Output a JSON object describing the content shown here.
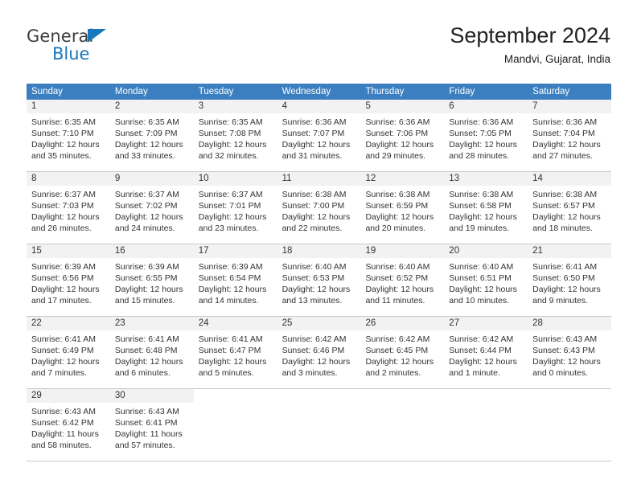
{
  "logo": {
    "name_top": "General",
    "name_bottom": "Blue",
    "triangle_color": "#1878be",
    "top_color": "#3c3c3c"
  },
  "header": {
    "title": "September 2024",
    "subtitle": "Mandvi, Gujarat, India"
  },
  "theme": {
    "header_bg": "#3c7fc0",
    "header_text": "#ffffff",
    "daynum_band_bg": "#f2f2f2",
    "grid_line": "#c8c8c8"
  },
  "weekdays": [
    {
      "label": "Sunday"
    },
    {
      "label": "Monday"
    },
    {
      "label": "Tuesday"
    },
    {
      "label": "Wednesday"
    },
    {
      "label": "Thursday"
    },
    {
      "label": "Friday"
    },
    {
      "label": "Saturday"
    }
  ],
  "weeks": [
    [
      {
        "day": "1",
        "sunrise": "Sunrise: 6:35 AM",
        "sunset": "Sunset: 7:10 PM",
        "daylight1": "Daylight: 12 hours",
        "daylight2": "and 35 minutes."
      },
      {
        "day": "2",
        "sunrise": "Sunrise: 6:35 AM",
        "sunset": "Sunset: 7:09 PM",
        "daylight1": "Daylight: 12 hours",
        "daylight2": "and 33 minutes."
      },
      {
        "day": "3",
        "sunrise": "Sunrise: 6:35 AM",
        "sunset": "Sunset: 7:08 PM",
        "daylight1": "Daylight: 12 hours",
        "daylight2": "and 32 minutes."
      },
      {
        "day": "4",
        "sunrise": "Sunrise: 6:36 AM",
        "sunset": "Sunset: 7:07 PM",
        "daylight1": "Daylight: 12 hours",
        "daylight2": "and 31 minutes."
      },
      {
        "day": "5",
        "sunrise": "Sunrise: 6:36 AM",
        "sunset": "Sunset: 7:06 PM",
        "daylight1": "Daylight: 12 hours",
        "daylight2": "and 29 minutes."
      },
      {
        "day": "6",
        "sunrise": "Sunrise: 6:36 AM",
        "sunset": "Sunset: 7:05 PM",
        "daylight1": "Daylight: 12 hours",
        "daylight2": "and 28 minutes."
      },
      {
        "day": "7",
        "sunrise": "Sunrise: 6:36 AM",
        "sunset": "Sunset: 7:04 PM",
        "daylight1": "Daylight: 12 hours",
        "daylight2": "and 27 minutes."
      }
    ],
    [
      {
        "day": "8",
        "sunrise": "Sunrise: 6:37 AM",
        "sunset": "Sunset: 7:03 PM",
        "daylight1": "Daylight: 12 hours",
        "daylight2": "and 26 minutes."
      },
      {
        "day": "9",
        "sunrise": "Sunrise: 6:37 AM",
        "sunset": "Sunset: 7:02 PM",
        "daylight1": "Daylight: 12 hours",
        "daylight2": "and 24 minutes."
      },
      {
        "day": "10",
        "sunrise": "Sunrise: 6:37 AM",
        "sunset": "Sunset: 7:01 PM",
        "daylight1": "Daylight: 12 hours",
        "daylight2": "and 23 minutes."
      },
      {
        "day": "11",
        "sunrise": "Sunrise: 6:38 AM",
        "sunset": "Sunset: 7:00 PM",
        "daylight1": "Daylight: 12 hours",
        "daylight2": "and 22 minutes."
      },
      {
        "day": "12",
        "sunrise": "Sunrise: 6:38 AM",
        "sunset": "Sunset: 6:59 PM",
        "daylight1": "Daylight: 12 hours",
        "daylight2": "and 20 minutes."
      },
      {
        "day": "13",
        "sunrise": "Sunrise: 6:38 AM",
        "sunset": "Sunset: 6:58 PM",
        "daylight1": "Daylight: 12 hours",
        "daylight2": "and 19 minutes."
      },
      {
        "day": "14",
        "sunrise": "Sunrise: 6:38 AM",
        "sunset": "Sunset: 6:57 PM",
        "daylight1": "Daylight: 12 hours",
        "daylight2": "and 18 minutes."
      }
    ],
    [
      {
        "day": "15",
        "sunrise": "Sunrise: 6:39 AM",
        "sunset": "Sunset: 6:56 PM",
        "daylight1": "Daylight: 12 hours",
        "daylight2": "and 17 minutes."
      },
      {
        "day": "16",
        "sunrise": "Sunrise: 6:39 AM",
        "sunset": "Sunset: 6:55 PM",
        "daylight1": "Daylight: 12 hours",
        "daylight2": "and 15 minutes."
      },
      {
        "day": "17",
        "sunrise": "Sunrise: 6:39 AM",
        "sunset": "Sunset: 6:54 PM",
        "daylight1": "Daylight: 12 hours",
        "daylight2": "and 14 minutes."
      },
      {
        "day": "18",
        "sunrise": "Sunrise: 6:40 AM",
        "sunset": "Sunset: 6:53 PM",
        "daylight1": "Daylight: 12 hours",
        "daylight2": "and 13 minutes."
      },
      {
        "day": "19",
        "sunrise": "Sunrise: 6:40 AM",
        "sunset": "Sunset: 6:52 PM",
        "daylight1": "Daylight: 12 hours",
        "daylight2": "and 11 minutes."
      },
      {
        "day": "20",
        "sunrise": "Sunrise: 6:40 AM",
        "sunset": "Sunset: 6:51 PM",
        "daylight1": "Daylight: 12 hours",
        "daylight2": "and 10 minutes."
      },
      {
        "day": "21",
        "sunrise": "Sunrise: 6:41 AM",
        "sunset": "Sunset: 6:50 PM",
        "daylight1": "Daylight: 12 hours",
        "daylight2": "and 9 minutes."
      }
    ],
    [
      {
        "day": "22",
        "sunrise": "Sunrise: 6:41 AM",
        "sunset": "Sunset: 6:49 PM",
        "daylight1": "Daylight: 12 hours",
        "daylight2": "and 7 minutes."
      },
      {
        "day": "23",
        "sunrise": "Sunrise: 6:41 AM",
        "sunset": "Sunset: 6:48 PM",
        "daylight1": "Daylight: 12 hours",
        "daylight2": "and 6 minutes."
      },
      {
        "day": "24",
        "sunrise": "Sunrise: 6:41 AM",
        "sunset": "Sunset: 6:47 PM",
        "daylight1": "Daylight: 12 hours",
        "daylight2": "and 5 minutes."
      },
      {
        "day": "25",
        "sunrise": "Sunrise: 6:42 AM",
        "sunset": "Sunset: 6:46 PM",
        "daylight1": "Daylight: 12 hours",
        "daylight2": "and 3 minutes."
      },
      {
        "day": "26",
        "sunrise": "Sunrise: 6:42 AM",
        "sunset": "Sunset: 6:45 PM",
        "daylight1": "Daylight: 12 hours",
        "daylight2": "and 2 minutes."
      },
      {
        "day": "27",
        "sunrise": "Sunrise: 6:42 AM",
        "sunset": "Sunset: 6:44 PM",
        "daylight1": "Daylight: 12 hours",
        "daylight2": "and 1 minute."
      },
      {
        "day": "28",
        "sunrise": "Sunrise: 6:43 AM",
        "sunset": "Sunset: 6:43 PM",
        "daylight1": "Daylight: 12 hours",
        "daylight2": "and 0 minutes."
      }
    ],
    [
      {
        "day": "29",
        "sunrise": "Sunrise: 6:43 AM",
        "sunset": "Sunset: 6:42 PM",
        "daylight1": "Daylight: 11 hours",
        "daylight2": "and 58 minutes."
      },
      {
        "day": "30",
        "sunrise": "Sunrise: 6:43 AM",
        "sunset": "Sunset: 6:41 PM",
        "daylight1": "Daylight: 11 hours",
        "daylight2": "and 57 minutes."
      },
      {
        "day": "",
        "sunrise": "",
        "sunset": "",
        "daylight1": "",
        "daylight2": ""
      },
      {
        "day": "",
        "sunrise": "",
        "sunset": "",
        "daylight1": "",
        "daylight2": ""
      },
      {
        "day": "",
        "sunrise": "",
        "sunset": "",
        "daylight1": "",
        "daylight2": ""
      },
      {
        "day": "",
        "sunrise": "",
        "sunset": "",
        "daylight1": "",
        "daylight2": ""
      },
      {
        "day": "",
        "sunrise": "",
        "sunset": "",
        "daylight1": "",
        "daylight2": ""
      }
    ]
  ]
}
